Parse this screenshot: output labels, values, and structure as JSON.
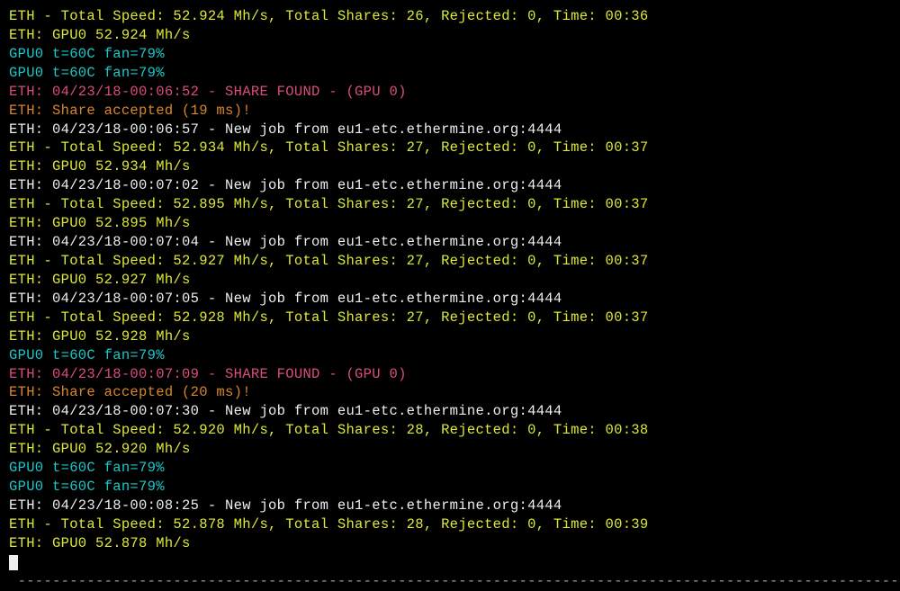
{
  "lines": [
    {
      "color": "yellow",
      "text": "ETH - Total Speed: 52.924 Mh/s, Total Shares: 26, Rejected: 0, Time: 00:36"
    },
    {
      "color": "yellow",
      "text": "ETH: GPU0 52.924 Mh/s"
    },
    {
      "color": "cyan",
      "text": "GPU0 t=60C fan=79%"
    },
    {
      "color": "cyan",
      "text": "GPU0 t=60C fan=79%"
    },
    {
      "color": "pink",
      "text": "ETH: 04/23/18-00:06:52 - SHARE FOUND - (GPU 0)"
    },
    {
      "color": "orange",
      "text": "ETH: Share accepted (19 ms)!"
    },
    {
      "color": "white",
      "text": "ETH: 04/23/18-00:06:57 - New job from eu1-etc.ethermine.org:4444"
    },
    {
      "color": "yellow",
      "text": "ETH - Total Speed: 52.934 Mh/s, Total Shares: 27, Rejected: 0, Time: 00:37"
    },
    {
      "color": "yellow",
      "text": "ETH: GPU0 52.934 Mh/s"
    },
    {
      "color": "white",
      "text": "ETH: 04/23/18-00:07:02 - New job from eu1-etc.ethermine.org:4444"
    },
    {
      "color": "yellow",
      "text": "ETH - Total Speed: 52.895 Mh/s, Total Shares: 27, Rejected: 0, Time: 00:37"
    },
    {
      "color": "yellow",
      "text": "ETH: GPU0 52.895 Mh/s"
    },
    {
      "color": "white",
      "text": "ETH: 04/23/18-00:07:04 - New job from eu1-etc.ethermine.org:4444"
    },
    {
      "color": "yellow",
      "text": "ETH - Total Speed: 52.927 Mh/s, Total Shares: 27, Rejected: 0, Time: 00:37"
    },
    {
      "color": "yellow",
      "text": "ETH: GPU0 52.927 Mh/s"
    },
    {
      "color": "white",
      "text": "ETH: 04/23/18-00:07:05 - New job from eu1-etc.ethermine.org:4444"
    },
    {
      "color": "yellow",
      "text": "ETH - Total Speed: 52.928 Mh/s, Total Shares: 27, Rejected: 0, Time: 00:37"
    },
    {
      "color": "yellow",
      "text": "ETH: GPU0 52.928 Mh/s"
    },
    {
      "color": "cyan",
      "text": "GPU0 t=60C fan=79%"
    },
    {
      "color": "pink",
      "text": "ETH: 04/23/18-00:07:09 - SHARE FOUND - (GPU 0)"
    },
    {
      "color": "orange",
      "text": "ETH: Share accepted (20 ms)!"
    },
    {
      "color": "white",
      "text": "ETH: 04/23/18-00:07:30 - New job from eu1-etc.ethermine.org:4444"
    },
    {
      "color": "yellow",
      "text": "ETH - Total Speed: 52.920 Mh/s, Total Shares: 28, Rejected: 0, Time: 00:38"
    },
    {
      "color": "yellow",
      "text": "ETH: GPU0 52.920 Mh/s"
    },
    {
      "color": "cyan",
      "text": "GPU0 t=60C fan=79%"
    },
    {
      "color": "cyan",
      "text": "GPU0 t=60C fan=79%"
    },
    {
      "color": "white",
      "text": "ETH: 04/23/18-00:08:25 - New job from eu1-etc.ethermine.org:4444"
    },
    {
      "color": "yellow",
      "text": "ETH - Total Speed: 52.878 Mh/s, Total Shares: 28, Rejected: 0, Time: 00:39"
    },
    {
      "color": "yellow",
      "text": "ETH: GPU0 52.878 Mh/s"
    }
  ],
  "divider": " -------------------------------------------------------------------------------------------------------"
}
